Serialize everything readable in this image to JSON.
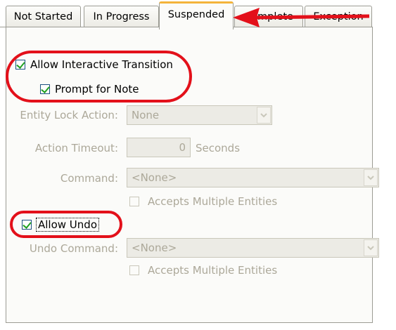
{
  "tabs": [
    "Not Started",
    "In Progress",
    "Suspended",
    "Complete",
    "Exception"
  ],
  "active_tab": "Suspended",
  "allow_interactive_transition": {
    "label": "Allow Interactive Transition",
    "checked": true
  },
  "prompt_for_note": {
    "label": "Prompt for Note",
    "checked": true
  },
  "entity_lock_action": {
    "label": "Entity Lock Action:",
    "value": "None"
  },
  "action_timeout": {
    "label": "Action Timeout:",
    "value": "0",
    "unit": "Seconds"
  },
  "command": {
    "label": "Command:",
    "value": "<None>",
    "accepts_multiple": {
      "label": "Accepts Multiple Entities",
      "checked": false
    }
  },
  "allow_undo": {
    "label": "Allow Undo",
    "checked": true
  },
  "undo_command": {
    "label": "Undo Command:",
    "value": "<None>",
    "accepts_multiple": {
      "label": "Accepts Multiple Entities",
      "checked": false
    }
  },
  "colors": {
    "annotation": "#e3101a",
    "active_tab_accent": "#f4b33a",
    "check": "#21a121"
  },
  "icons": {
    "dropdown": "chevron-down-icon",
    "arrow": "red-arrow-left"
  }
}
